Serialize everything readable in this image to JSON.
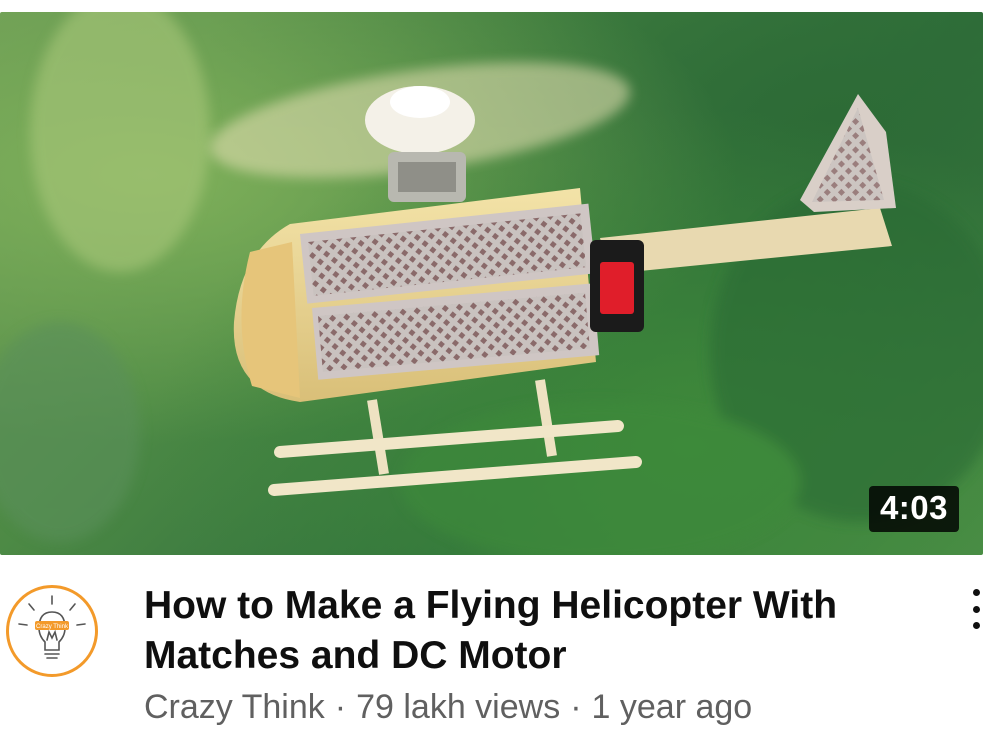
{
  "video": {
    "duration": "4:03",
    "title": "How to Make a Flying Helicopter With Matches and DC Motor",
    "channel": "Crazy Think",
    "views": "79 lakh views",
    "age": "1 year ago",
    "separator": "·",
    "avatar_text": "Crazy Think"
  },
  "icons": {
    "more": "more-vert-icon",
    "avatar": "lightbulb-icon"
  },
  "colors": {
    "title": "#0f0f0f",
    "subtext": "#606060",
    "avatar_ring": "#f39a2a",
    "duration_bg": "#000000"
  }
}
